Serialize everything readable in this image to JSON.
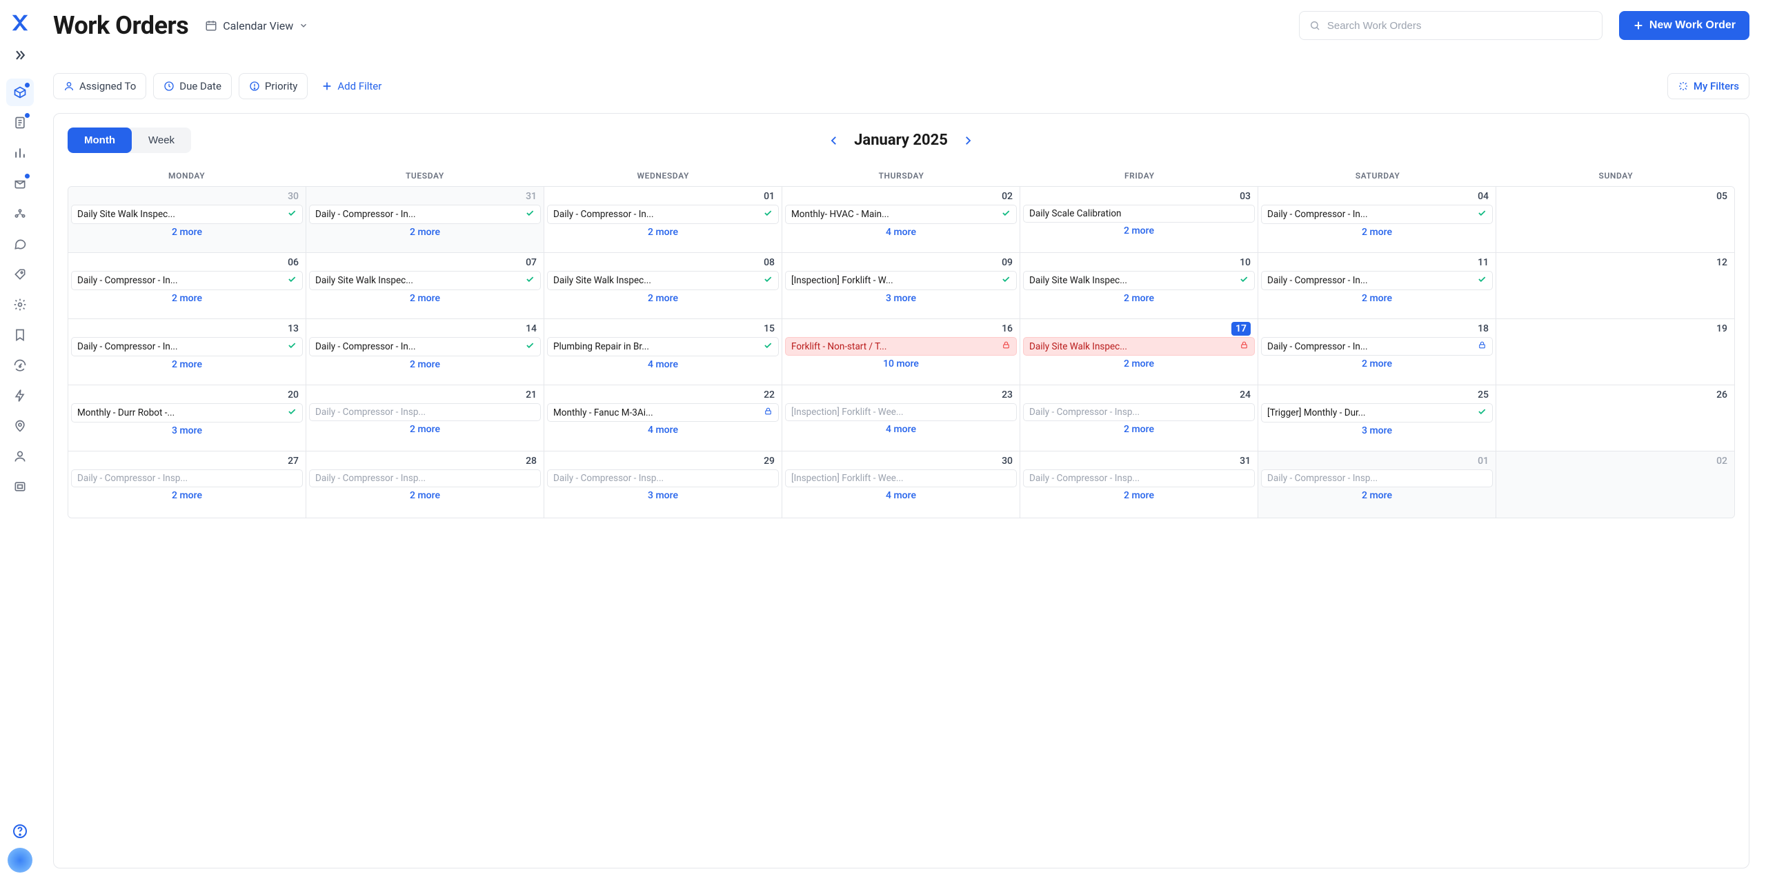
{
  "page_title": "Work Orders",
  "view_selector": "Calendar View",
  "search_placeholder": "Search Work Orders",
  "new_button": "New Work Order",
  "filters": {
    "assigned_to": "Assigned To",
    "due_date": "Due Date",
    "priority": "Priority",
    "add_filter": "Add Filter",
    "my_filters": "My Filters"
  },
  "view_toggle": {
    "month": "Month",
    "week": "Week"
  },
  "current_month": "January 2025",
  "day_headers": [
    "MONDAY",
    "TUESDAY",
    "WEDNESDAY",
    "THURSDAY",
    "FRIDAY",
    "SATURDAY",
    "SUNDAY"
  ],
  "weeks": [
    [
      {
        "num": "30",
        "dim": true,
        "event": {
          "title": "Daily Site Walk Inspec...",
          "icon": "check"
        },
        "more": "2 more"
      },
      {
        "num": "31",
        "dim": true,
        "event": {
          "title": "Daily - Compressor - In...",
          "icon": "check"
        },
        "more": "2 more"
      },
      {
        "num": "01",
        "event": {
          "title": "Daily - Compressor - In...",
          "icon": "check"
        },
        "more": "2 more"
      },
      {
        "num": "02",
        "event": {
          "title": "Monthly- HVAC - Main...",
          "icon": "check"
        },
        "more": "4 more"
      },
      {
        "num": "03",
        "event": {
          "title": "Daily Scale Calibration"
        },
        "more": "2 more"
      },
      {
        "num": "04",
        "event": {
          "title": "Daily - Compressor - In...",
          "icon": "check"
        },
        "more": "2 more"
      },
      {
        "num": "05"
      }
    ],
    [
      {
        "num": "06",
        "event": {
          "title": "Daily - Compressor - In...",
          "icon": "check"
        },
        "more": "2 more"
      },
      {
        "num": "07",
        "event": {
          "title": "Daily Site Walk Inspec...",
          "icon": "check"
        },
        "more": "2 more"
      },
      {
        "num": "08",
        "event": {
          "title": "Daily Site Walk Inspec...",
          "icon": "check"
        },
        "more": "2 more"
      },
      {
        "num": "09",
        "event": {
          "title": "[Inspection] Forklift - W...",
          "icon": "check"
        },
        "more": "3 more"
      },
      {
        "num": "10",
        "event": {
          "title": "Daily Site Walk Inspec...",
          "icon": "check"
        },
        "more": "2 more"
      },
      {
        "num": "11",
        "event": {
          "title": "Daily - Compressor - In...",
          "icon": "check"
        },
        "more": "2 more"
      },
      {
        "num": "12"
      }
    ],
    [
      {
        "num": "13",
        "event": {
          "title": "Daily - Compressor - In...",
          "icon": "check"
        },
        "more": "2 more"
      },
      {
        "num": "14",
        "event": {
          "title": "Daily - Compressor - In...",
          "icon": "check"
        },
        "more": "2 more"
      },
      {
        "num": "15",
        "event": {
          "title": "Plumbing Repair in Br...",
          "icon": "check"
        },
        "more": "4 more"
      },
      {
        "num": "16",
        "event": {
          "title": "Forklift - Non-start / T...",
          "icon": "lock",
          "alert": true
        },
        "more": "10 more"
      },
      {
        "num": "17",
        "today": true,
        "event": {
          "title": "Daily Site Walk Inspec...",
          "icon": "lock",
          "alert": true
        },
        "more": "2 more"
      },
      {
        "num": "18",
        "event": {
          "title": "Daily - Compressor - In...",
          "icon": "lock-blue"
        },
        "more": "2 more"
      },
      {
        "num": "19"
      }
    ],
    [
      {
        "num": "20",
        "event": {
          "title": "Monthly - Durr Robot -...",
          "icon": "check"
        },
        "more": "3 more"
      },
      {
        "num": "21",
        "event": {
          "title": "Daily - Compressor - Insp...",
          "muted": true
        },
        "more": "2 more"
      },
      {
        "num": "22",
        "event": {
          "title": "Monthly - Fanuc M-3Ai...",
          "icon": "lock-blue"
        },
        "more": "4 more"
      },
      {
        "num": "23",
        "event": {
          "title": "[Inspection] Forklift - Wee...",
          "muted": true
        },
        "more": "4 more"
      },
      {
        "num": "24",
        "event": {
          "title": "Daily - Compressor - Insp...",
          "muted": true
        },
        "more": "2 more"
      },
      {
        "num": "25",
        "event": {
          "title": "[Trigger] Monthly - Dur...",
          "icon": "check"
        },
        "more": "3 more"
      },
      {
        "num": "26"
      }
    ],
    [
      {
        "num": "27",
        "event": {
          "title": "Daily - Compressor - Insp...",
          "muted": true
        },
        "more": "2 more"
      },
      {
        "num": "28",
        "event": {
          "title": "Daily - Compressor - Insp...",
          "muted": true
        },
        "more": "2 more"
      },
      {
        "num": "29",
        "event": {
          "title": "Daily - Compressor - Insp...",
          "muted": true
        },
        "more": "3 more"
      },
      {
        "num": "30",
        "event": {
          "title": "[Inspection] Forklift - Wee...",
          "muted": true
        },
        "more": "4 more"
      },
      {
        "num": "31",
        "event": {
          "title": "Daily - Compressor - Insp...",
          "muted": true
        },
        "more": "2 more"
      },
      {
        "num": "01",
        "dim": true,
        "event": {
          "title": "Daily - Compressor - Insp...",
          "muted": true
        },
        "more": "2 more"
      },
      {
        "num": "02",
        "dim": true
      }
    ]
  ]
}
